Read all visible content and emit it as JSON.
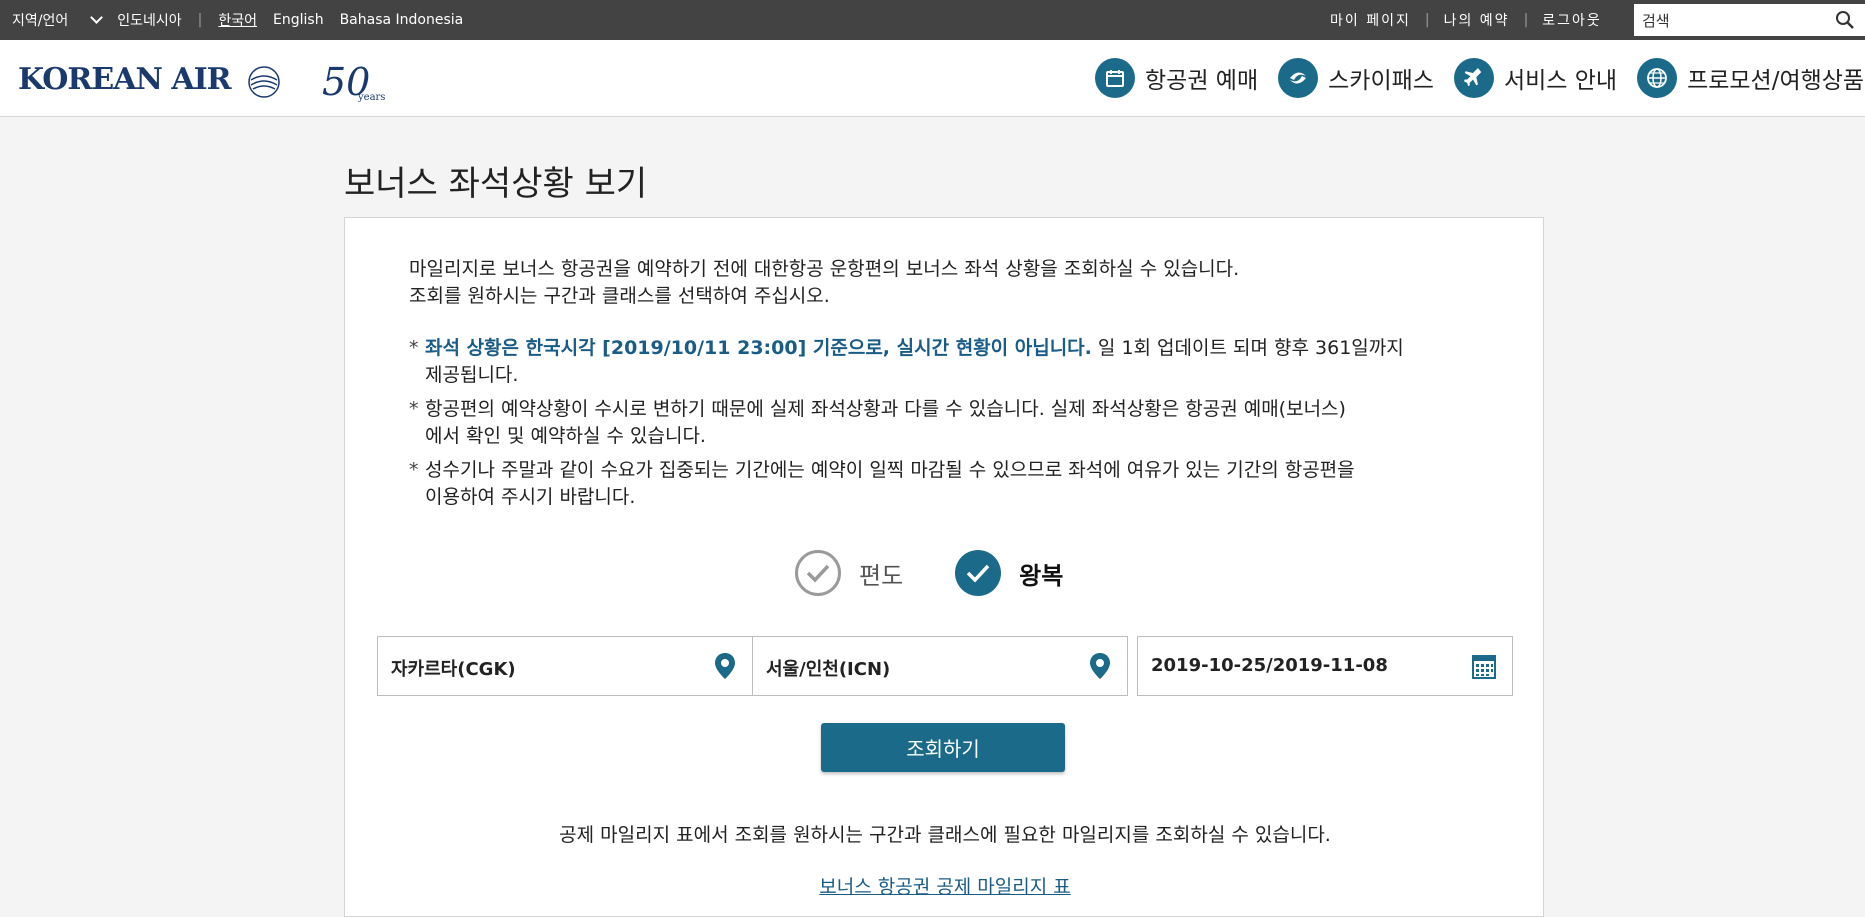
{
  "topbar": {
    "region_lang": "지역/언어",
    "country": "인도네시아",
    "lang_ko": "한국어",
    "lang_en": "English",
    "lang_id": "Bahasa Indonesia",
    "my_page": "마이 페이지",
    "my_booking": "나의 예약",
    "logout": "로그아웃",
    "search_placeholder": "검색"
  },
  "header": {
    "logo_text": "KOREAN AIR",
    "anniversary": "50",
    "anniversary_small": "years",
    "nav": [
      {
        "label": "항공권 예매",
        "icon": "calendar-icon"
      },
      {
        "label": "스카이패스",
        "icon": "skypass-icon"
      },
      {
        "label": "서비스 안내",
        "icon": "airplane-icon"
      },
      {
        "label": "프로모션/여행상품",
        "icon": "globe-icon"
      }
    ]
  },
  "main": {
    "title": "보너스 좌석상황 보기",
    "intro_line1": "마일리지로 보너스 항공권을 예약하기 전에 대한항공 운항편의 보너스 좌석 상황을 조회하실 수 있습니다.",
    "intro_line2": "조회를 원하시는 구간과 클래스를 선택하여 주십시오.",
    "note1_highlight": "좌석 상황은 한국시각 [2019/10/11 23:00] 기준으로, 실시간 현황이 아닙니다.",
    "note1_rest": " 일 1회 업데이트 되며 향후 361일까지",
    "note1_line2": "제공됩니다.",
    "note2_line1": "항공편의 예약상황이 수시로 변하기 때문에 실제 좌석상황과 다를 수 있습니다. 실제 좌석상황은 항공권 예매(보너스)",
    "note2_line2": "에서 확인 및 예약하실 수 있습니다.",
    "note3_line1": "성수기나 주말과 같이 수요가 집중되는 기간에는 예약이 일찍 마감될 수 있으므로 좌석에 여유가 있는 기간의 항공편을",
    "note3_line2": "이용하여 주시기 바랍니다.",
    "star": "*",
    "trip_oneway": "편도",
    "trip_roundtrip": "왕복",
    "selected_trip": "roundtrip",
    "origin": "자카르타(CGK)",
    "destination": "서울/인천(ICN)",
    "dates": "2019-10-25/2019-11-08",
    "search_button": "조회하기",
    "mileage_info": "공제 마일리지 표에서 조회를 원하시는 구간과 클래스에 필요한 마일리지를 조회하실 수 있습니다.",
    "mileage_link": "보너스 항공권 공제 마일리지 표"
  },
  "colors": {
    "topbar_bg": "#444343",
    "accent": "#1b6a8a",
    "highlight_text": "#1a5c88"
  }
}
